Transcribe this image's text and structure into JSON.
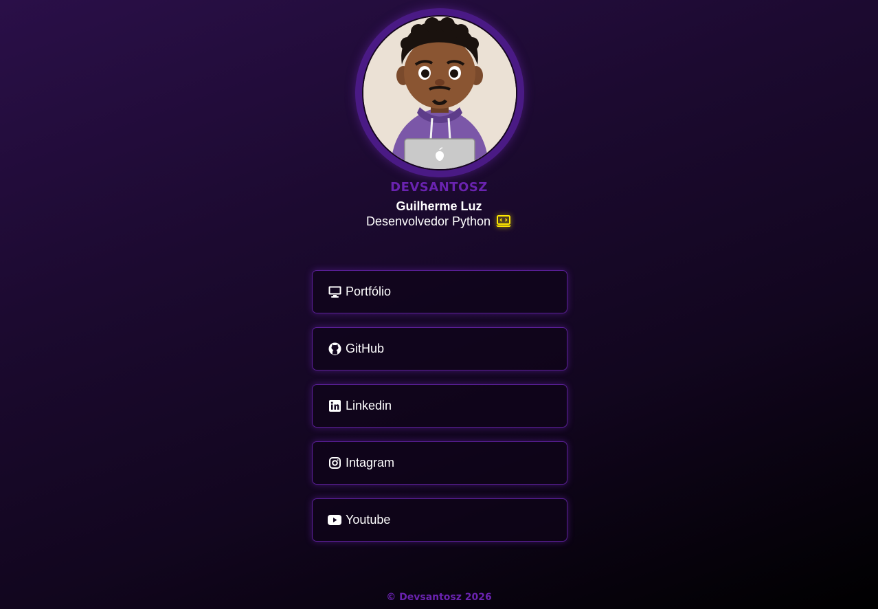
{
  "profile": {
    "handle": "DEVSANTOSZ",
    "name": "Guilherme Luz",
    "role": "Desenvolvedor Python",
    "role_icon": "laptop-code-icon",
    "avatar": "cartoon-developer-avatar"
  },
  "links": [
    {
      "label": "Portfólio",
      "icon": "desktop-icon"
    },
    {
      "label": "GitHub",
      "icon": "github-icon"
    },
    {
      "label": "Linkedin",
      "icon": "linkedin-icon"
    },
    {
      "label": "Intagram",
      "icon": "instagram-icon"
    },
    {
      "label": "Youtube",
      "icon": "youtube-icon"
    }
  ],
  "footer": {
    "text": "© Devsantosz 2026"
  },
  "colors": {
    "accent": "#6a23b0",
    "border": "#5a1f96",
    "highlight": "#ffe800"
  }
}
